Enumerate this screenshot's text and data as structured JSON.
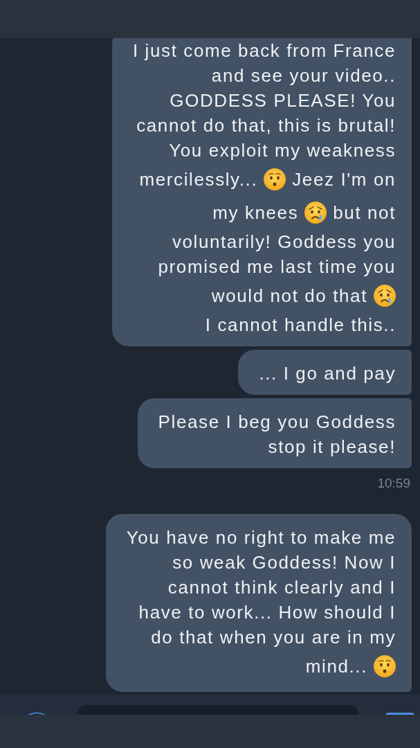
{
  "messages": [
    {
      "kind": "bubble",
      "lines": [
        [
          {
            "kind": "text",
            "text": "I just come back from France"
          }
        ],
        [
          {
            "kind": "text",
            "text": "and see your video.."
          }
        ],
        [
          {
            "kind": "text",
            "text": "GODDESS PLEASE! You"
          }
        ],
        [
          {
            "kind": "text",
            "text": "cannot do that, this is brutal!"
          }
        ],
        [
          {
            "kind": "text",
            "text": "You exploit my weakness"
          }
        ],
        [
          {
            "kind": "text",
            "text": "mercilessly..."
          },
          {
            "kind": "hushed"
          },
          {
            "kind": "text",
            "text": "Jeez I'm on"
          }
        ],
        [
          {
            "kind": "text",
            "text": "my knees"
          },
          {
            "kind": "crying"
          },
          {
            "kind": "text",
            "text": "but not"
          }
        ],
        [
          {
            "kind": "text",
            "text": "voluntarily! Goddess you"
          }
        ],
        [
          {
            "kind": "text",
            "text": "promised me last time you"
          }
        ],
        [
          {
            "kind": "text",
            "text": "would not do that"
          },
          {
            "kind": "crying"
          }
        ],
        [
          {
            "kind": "text",
            "text": "I cannot handle this.."
          }
        ]
      ]
    },
    {
      "kind": "bubble",
      "first_in_group": false,
      "lines": [
        [
          {
            "kind": "text",
            "text": "... I go and pay"
          }
        ]
      ]
    },
    {
      "kind": "bubble",
      "first_in_group": false,
      "lines": [
        [
          {
            "kind": "text",
            "text": "Please I beg you Goddess"
          }
        ],
        [
          {
            "kind": "text",
            "text": "stop it please!"
          }
        ]
      ]
    },
    {
      "kind": "time",
      "text": "10:59"
    },
    {
      "kind": "bubble",
      "first_in_group": true,
      "lines": [
        [
          {
            "kind": "text",
            "text": "You have no right to make me"
          }
        ],
        [
          {
            "kind": "text",
            "text": "so weak Goddess! Now I"
          }
        ],
        [
          {
            "kind": "text",
            "text": "cannot think clearly and I"
          }
        ],
        [
          {
            "kind": "text",
            "text": "have to work... How should I"
          }
        ],
        [
          {
            "kind": "text",
            "text": "do that when you are in my"
          }
        ],
        [
          {
            "kind": "text",
            "text": "mind..."
          },
          {
            "kind": "hushed"
          }
        ]
      ]
    }
  ]
}
